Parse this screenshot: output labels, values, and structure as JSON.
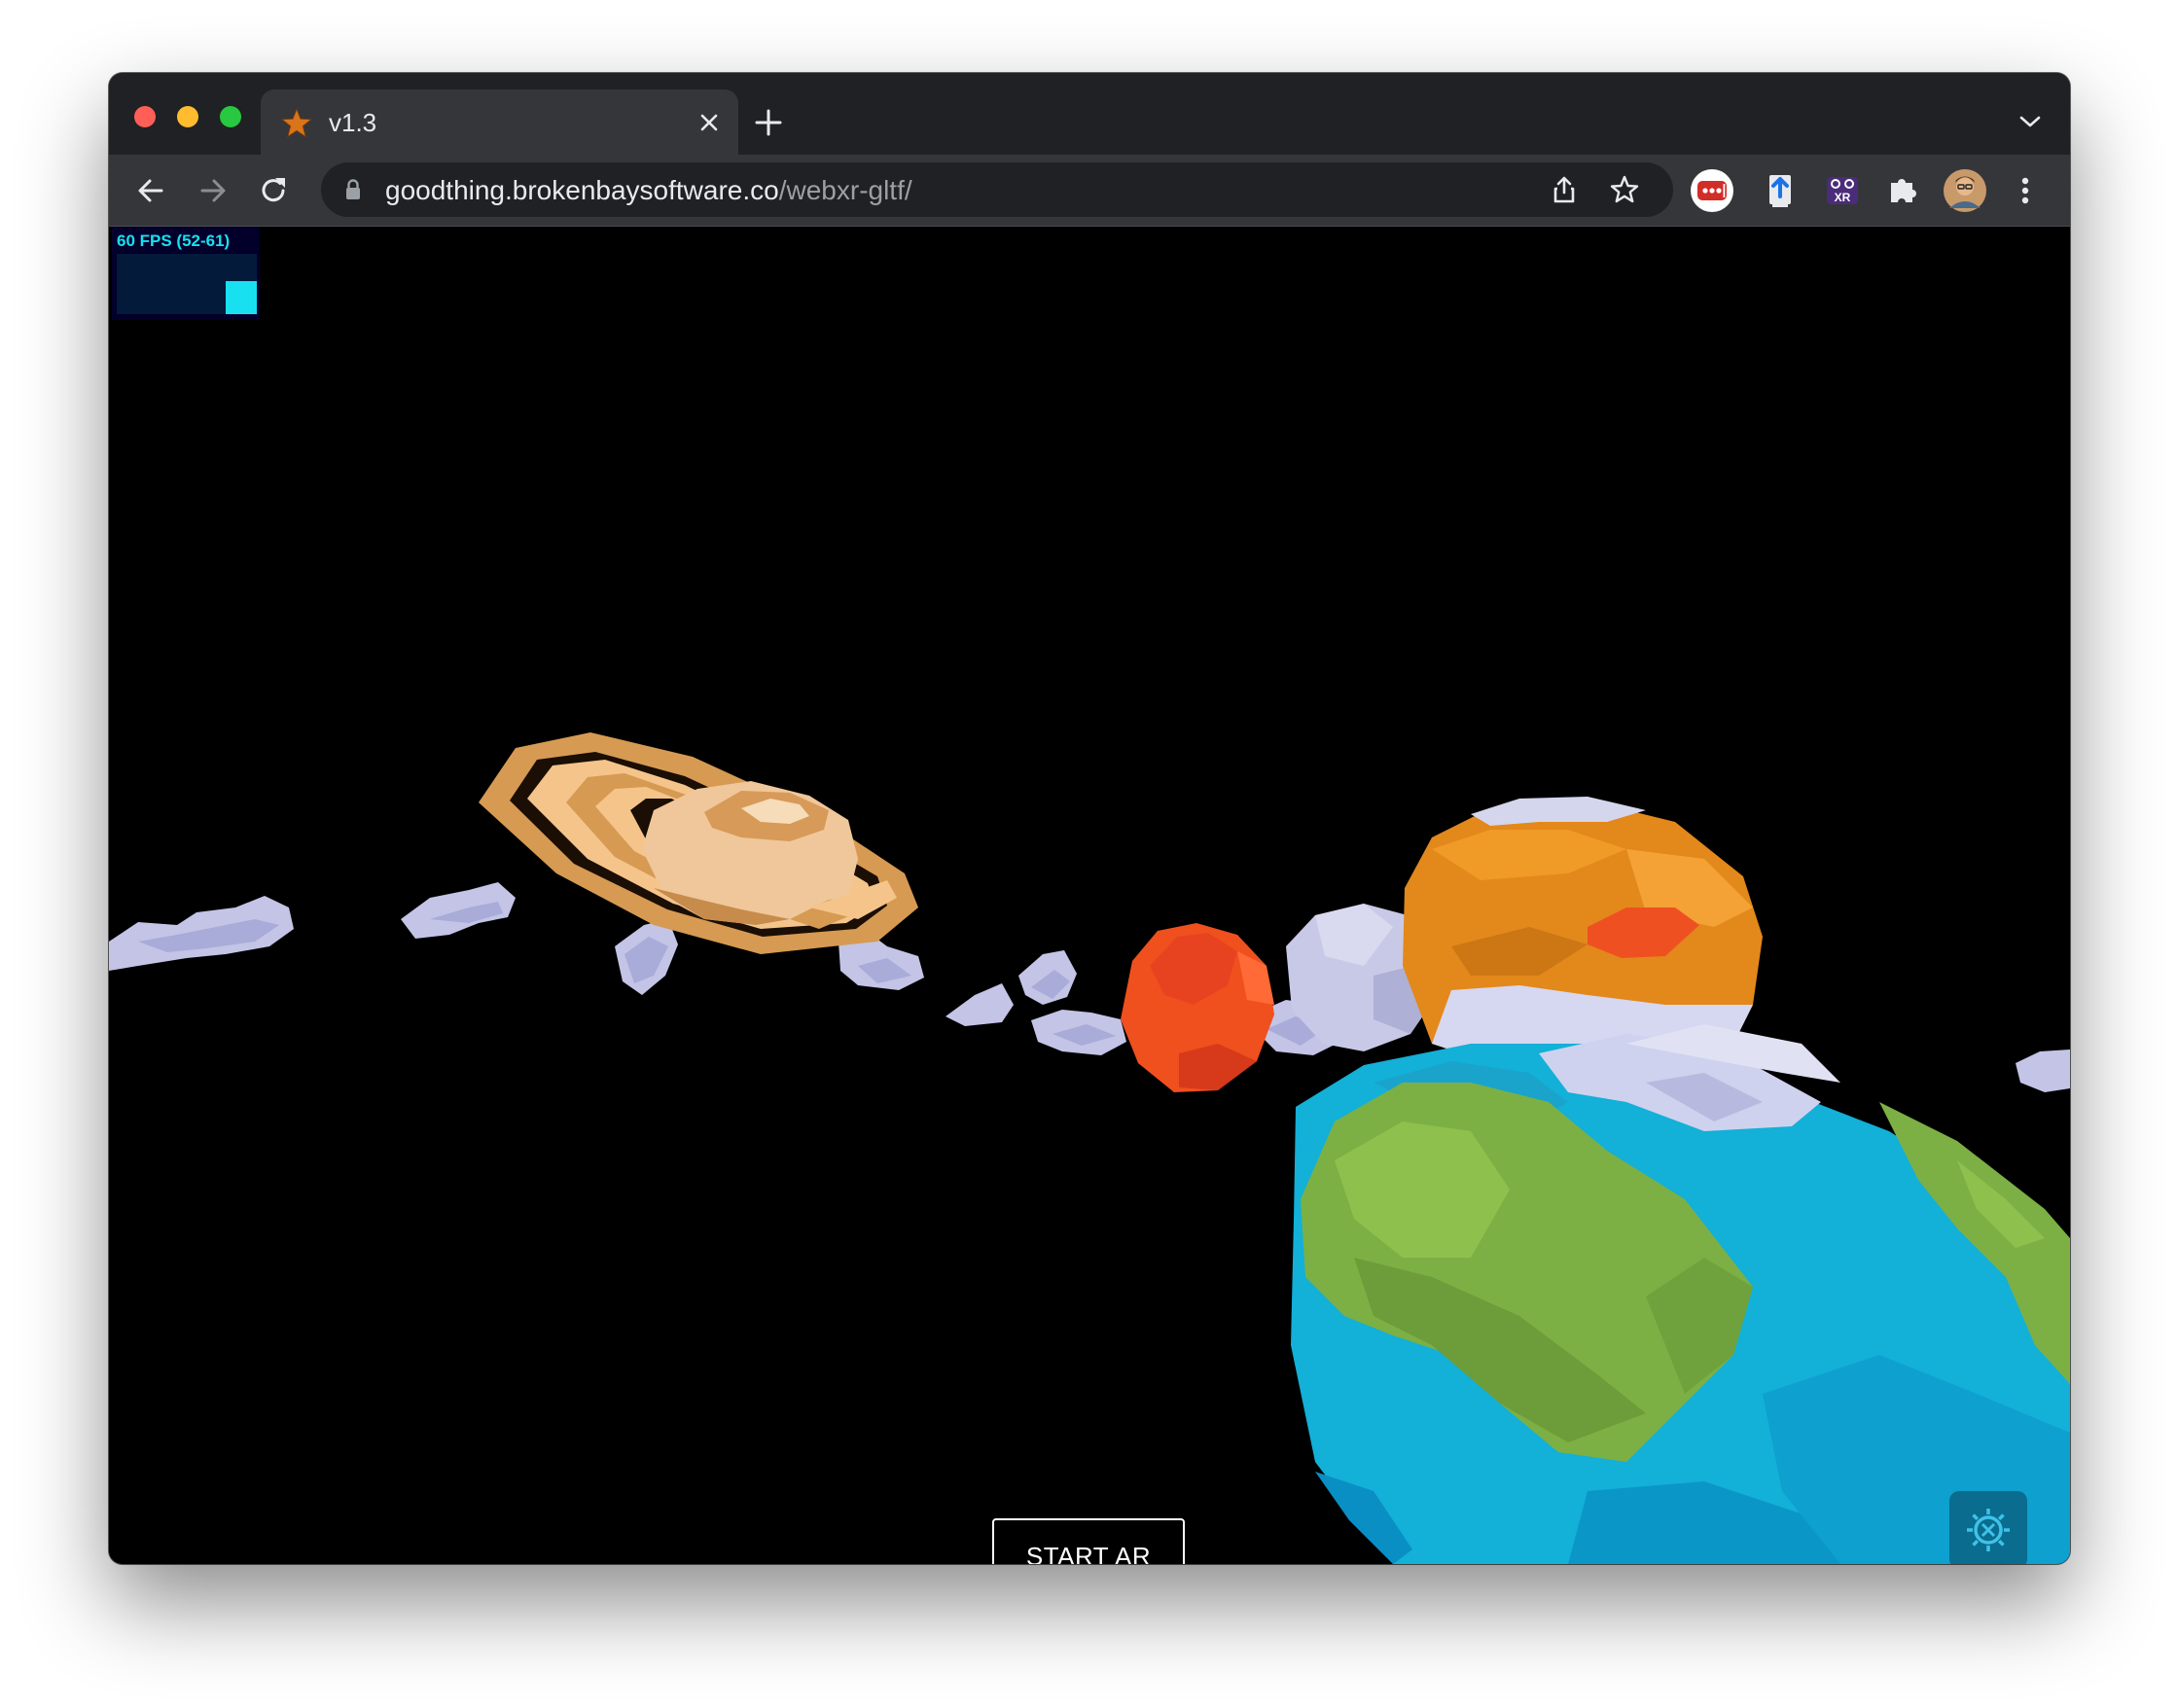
{
  "browser": {
    "tab": {
      "title": "v1.3",
      "favicon": "star-icon"
    },
    "url": {
      "domain": "goodthing.brokenbaysoftware.co",
      "path": "/webxr-gltf/"
    },
    "extensions": [
      "lastpass-icon",
      "upload-extension-icon",
      "webxr-emulator-icon",
      "puzzle-icon",
      "profile-avatar"
    ]
  },
  "stats": {
    "fps_label": "60 FPS (52-61)"
  },
  "scene": {
    "objects": [
      "saturn",
      "mars",
      "jupiter",
      "moon",
      "earth",
      "asteroids"
    ]
  },
  "buttons": {
    "start_ar": "START AR"
  },
  "icons": {
    "settings": "settings-gear-icon"
  },
  "colors": {
    "tabstrip": "#202124",
    "toolbar": "#35363a",
    "fps_text": "#18e0f0",
    "settings_bg": "#0a6c8e"
  }
}
